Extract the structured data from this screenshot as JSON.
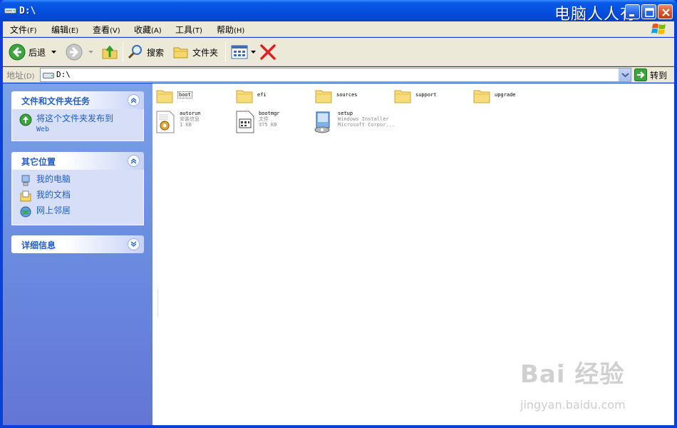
{
  "window": {
    "title": "D:\\",
    "brand": "电脑人人有"
  },
  "menu": [
    {
      "label": "文件",
      "acc": "(F)"
    },
    {
      "label": "编辑",
      "acc": "(E)"
    },
    {
      "label": "查看",
      "acc": "(V)"
    },
    {
      "label": "收藏",
      "acc": "(A)"
    },
    {
      "label": "工具",
      "acc": "(T)"
    },
    {
      "label": "帮助",
      "acc": "(H)"
    }
  ],
  "toolbar": {
    "back_label": "后退",
    "search_label": "搜索",
    "folders_label": "文件夹"
  },
  "address": {
    "label": "地址",
    "acc": "(D)",
    "value": "D:\\",
    "go_label": "转到"
  },
  "taskpane": {
    "tasks": {
      "title": "文件和文件夹任务",
      "items": [
        {
          "label": "将这个文件夹发布到",
          "label2": "Web"
        }
      ]
    },
    "places": {
      "title": "其它位置",
      "items": [
        {
          "label": "我的电脑"
        },
        {
          "label": "我的文档"
        },
        {
          "label": "网上邻居"
        }
      ]
    },
    "details": {
      "title": "详细信息"
    }
  },
  "files": {
    "folders": [
      {
        "name": "boot"
      },
      {
        "name": "efi"
      },
      {
        "name": "sources"
      },
      {
        "name": "support"
      },
      {
        "name": "upgrade"
      }
    ],
    "items": [
      {
        "name": "autorun",
        "type": "安装信息",
        "size": "1 KB"
      },
      {
        "name": "bootmgr",
        "type": "文件",
        "size": "375 KB"
      },
      {
        "name": "setup",
        "type": "Windows Installer",
        "size": "Microsoft Corpor..."
      }
    ]
  },
  "watermark": {
    "main": "Bai 经验",
    "sub": "jingyan.baidu.com"
  },
  "colors": {
    "titlebar": "#0550e0",
    "taskpane": "#6a8be0",
    "link": "#215dc6",
    "chrome": "#ece9d8"
  }
}
